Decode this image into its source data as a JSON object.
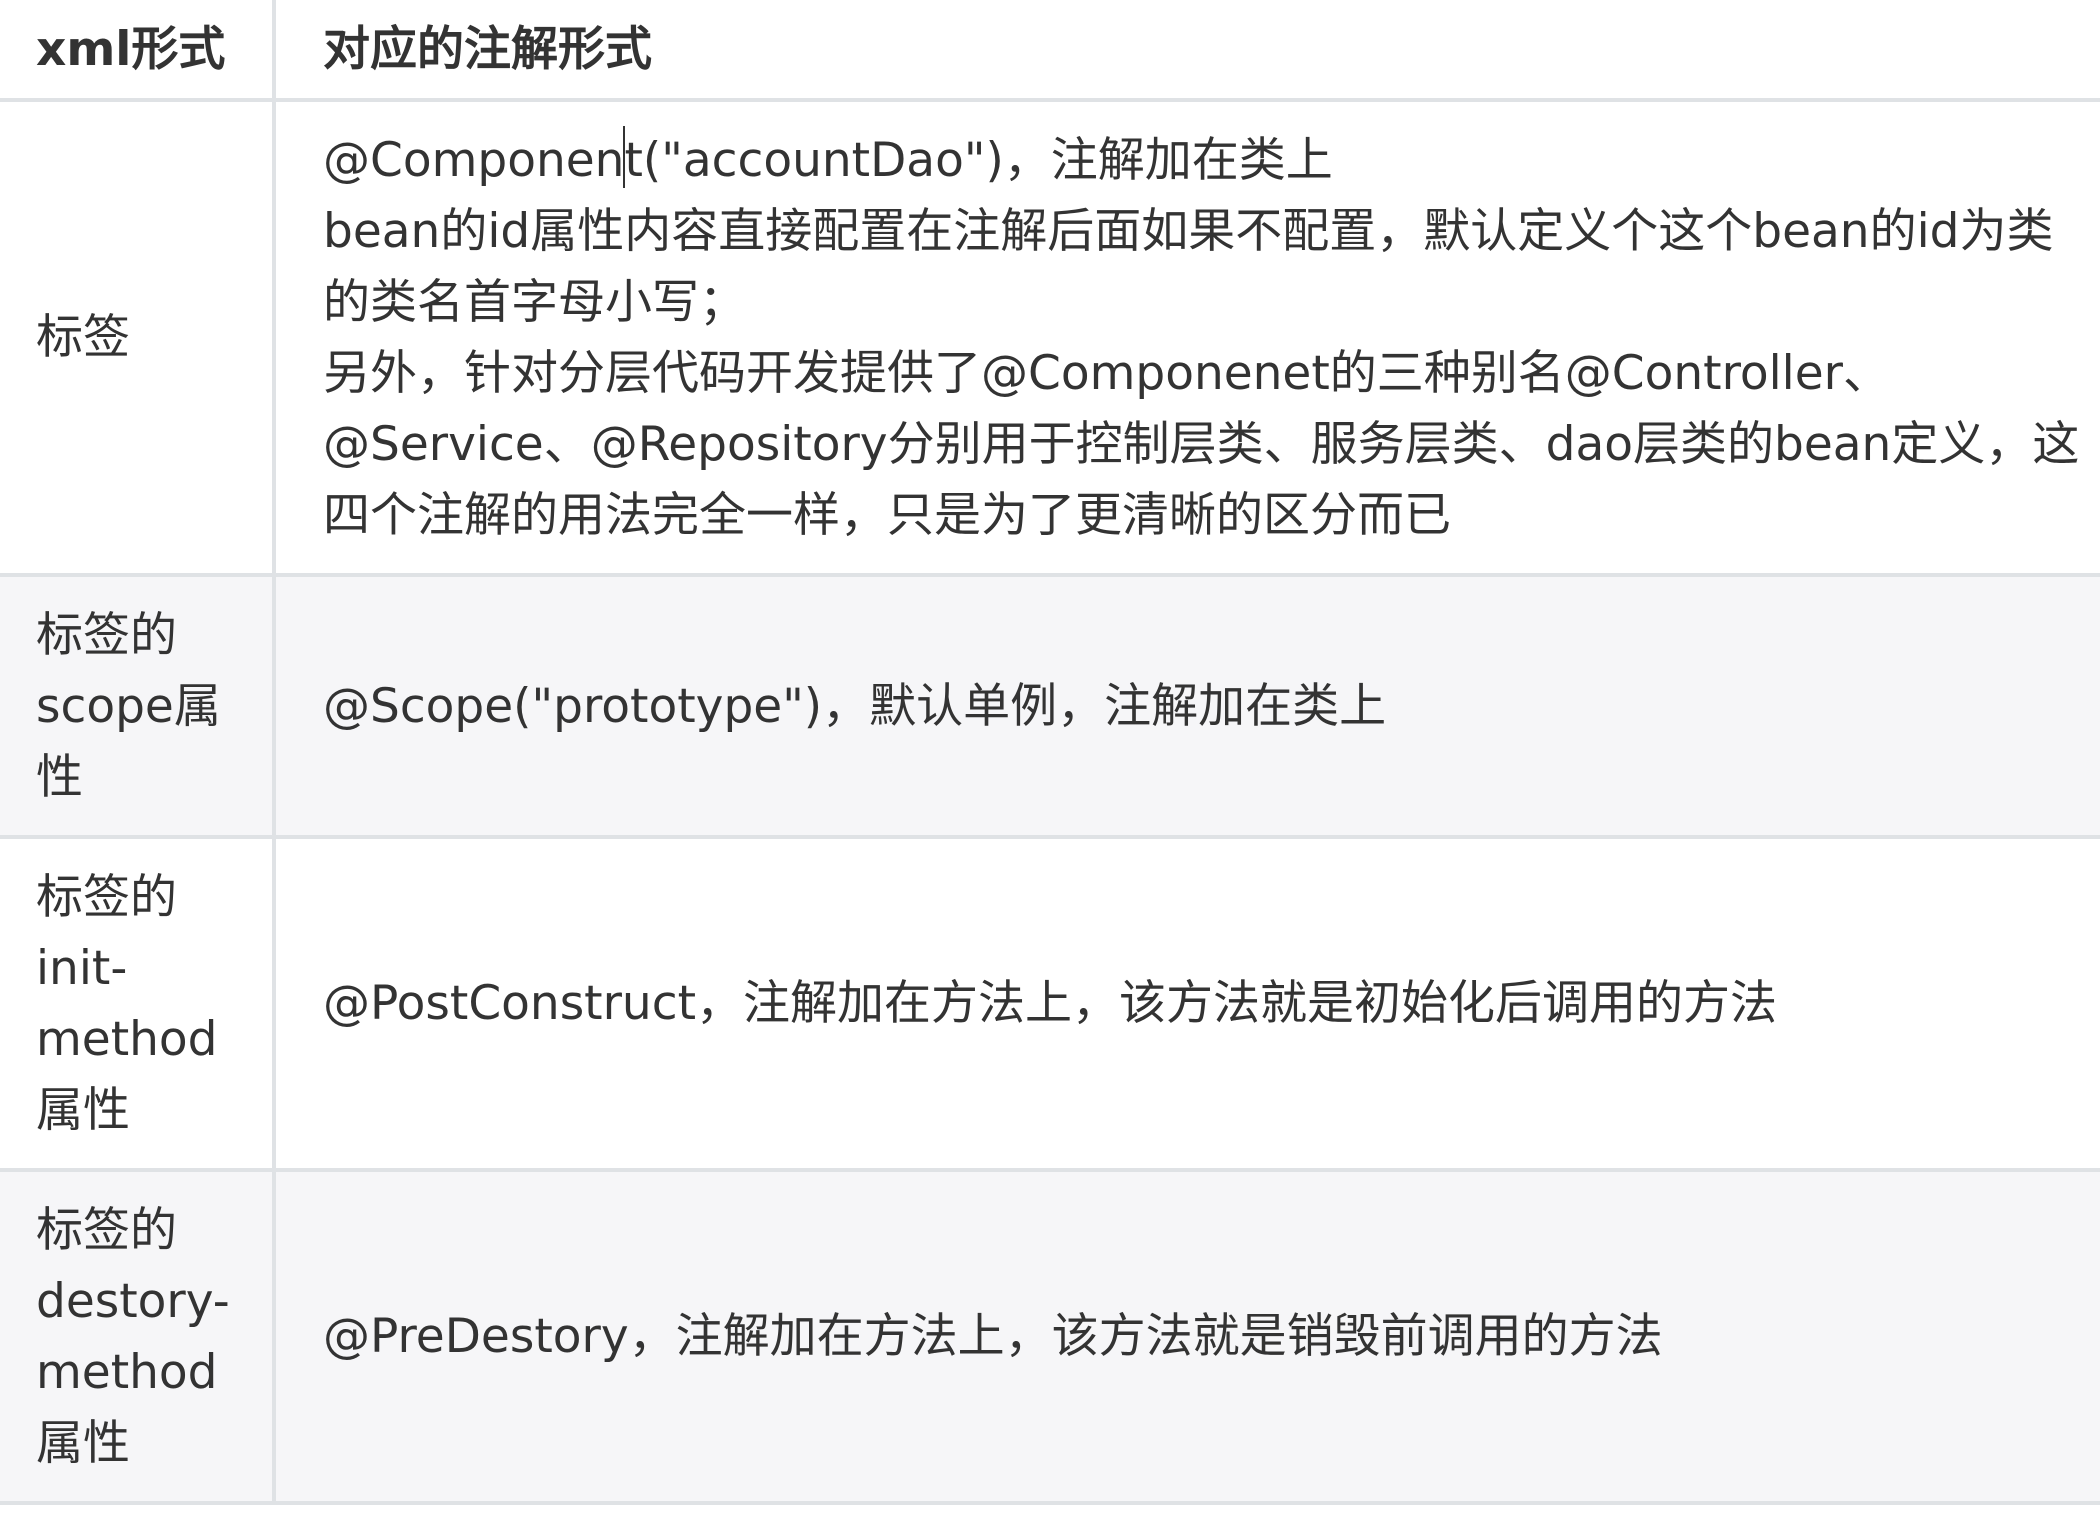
{
  "header": {
    "col1": "xml形式",
    "col2": "对应的注解形式"
  },
  "rows": [
    {
      "label": "标签",
      "lines": [
        "@Component(\"accountDao\")，注解加在类上",
        "bean的id属性内容直接配置在注解后面如果不配置，默认定义个这个bean的id为类",
        "的类名首字母小写；",
        "另外，针对分层代码开发提供了@Componenet的三种别名@Controller、",
        "@Service、@Repository分别用于控制层类、服务层类、dao层类的bean定义，这",
        "四个注解的用法完全一样，只是为了更清晰的区分而已"
      ]
    },
    {
      "label_lines": [
        "标签的",
        "scope属",
        "性"
      ],
      "text": "@Scope(\"prototype\")，默认单例，注解加在类上"
    },
    {
      "label_lines": [
        "标签的",
        "init-",
        "method",
        "属性"
      ],
      "text": "@PostConstruct，注解加在方法上，该方法就是初始化后调用的方法"
    },
    {
      "label_lines": [
        "标签的",
        "destory-",
        "method",
        "属性"
      ],
      "text": "@PreDestory，注解加在方法上，该方法就是销毁前调用的方法"
    }
  ]
}
